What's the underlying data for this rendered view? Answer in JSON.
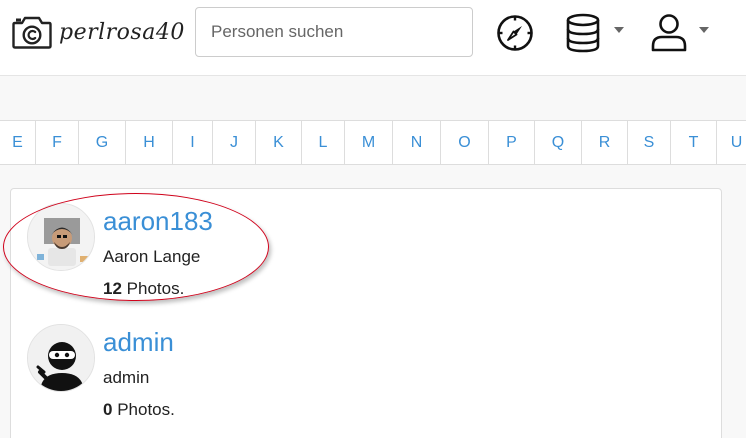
{
  "brand": {
    "name": "perlrosa40",
    "logo_icon": "camera-copyright-icon"
  },
  "search": {
    "placeholder": "Personen suchen",
    "value": ""
  },
  "nav": {
    "explore_icon": "compass-icon",
    "database_icon": "database-icon",
    "user_icon": "user-icon"
  },
  "alphabet": [
    "E",
    "F",
    "G",
    "H",
    "I",
    "J",
    "K",
    "L",
    "M",
    "N",
    "O",
    "P",
    "Q",
    "R",
    "S",
    "T",
    "U"
  ],
  "users": [
    {
      "username": "aaron183",
      "fullname": "Aaron Lange",
      "photo_count": "12",
      "photos_label": " Photos.",
      "highlighted": true
    },
    {
      "username": "admin",
      "fullname": "admin",
      "photo_count": "0",
      "photos_label": " Photos.",
      "highlighted": false
    }
  ],
  "colors": {
    "link": "#3a8fd6",
    "highlight": "#d0021b",
    "border": "#dddddd"
  }
}
